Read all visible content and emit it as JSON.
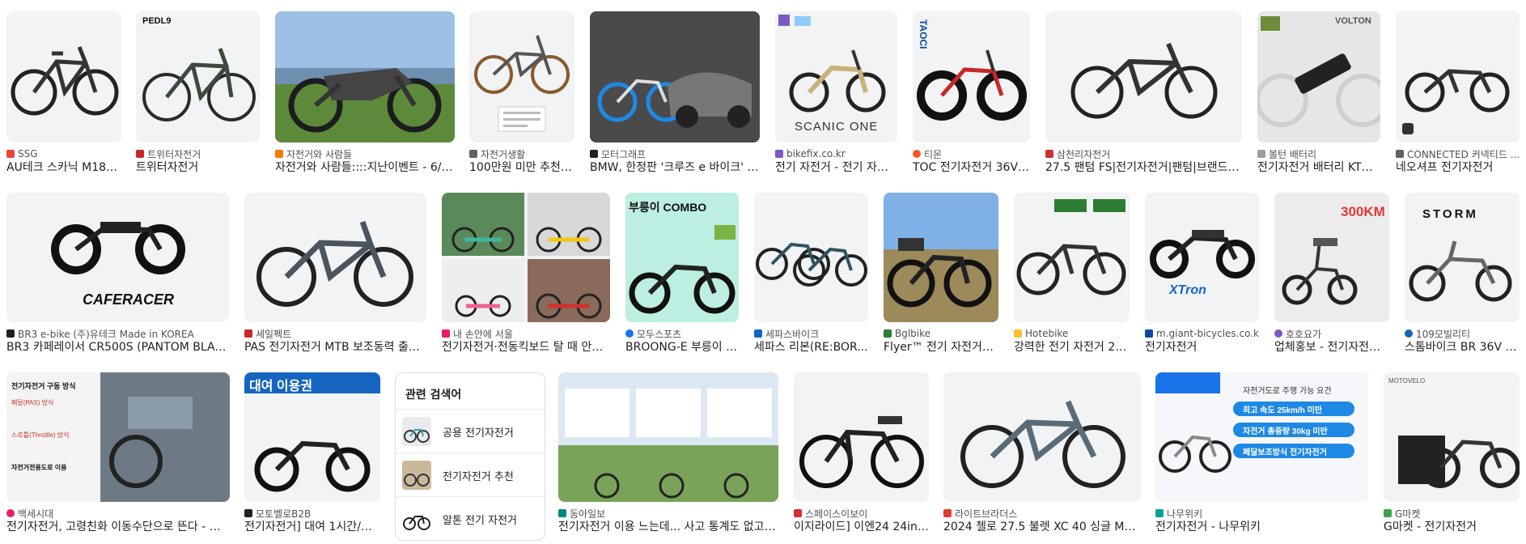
{
  "results": [
    {
      "source": "SSG",
      "title": "AU테크 스카닉 M180 ...",
      "favicon": "#e8453c"
    },
    {
      "source": "트위터자전거",
      "title": "트위터자전거",
      "favicon": "#c62828",
      "overlay": "PEDL9"
    },
    {
      "source": "자전거와 사람들",
      "title": "자전거와 사람들::::지난이벤트 - 6/3(...",
      "favicon": "#f57c00"
    },
    {
      "source": "자전거생활",
      "title": "100만원 미만 추천 ...",
      "favicon": "#5f6368"
    },
    {
      "source": "모터그래프",
      "title": "BMW, 한정판 '크루즈 e 바이크' 공...",
      "favicon": "#202124"
    },
    {
      "source": "bikefix.co.kr",
      "title": "전기 자전거 - 전기 자전...",
      "favicon": "#7e57c2",
      "overlay": "SCANIC ONE"
    },
    {
      "source": "티몬",
      "title": "TOC 전기자전거 36V ...",
      "favicon": "#ff5722",
      "overlay": "TAOCI"
    },
    {
      "source": "삼천리자전거",
      "title": "27.5 팬텀 FS|전기자전거|팬텀|브랜드|자...",
      "favicon": "#d32f2f"
    },
    {
      "source": "볼턴 배터리",
      "title": "전기자전거 배터리 KTX ...",
      "favicon": "#9e9e9e",
      "overlay": "VOLTON"
    },
    {
      "source": "CONNECTED 커넥티드 ...",
      "title": "네오셔프 전기자전거",
      "favicon": "#616161"
    },
    {
      "source": "BR3 e-bike (주)유테크 Made in KOREA",
      "title": "BR3 카페레이서 CR500S (PANTOM BLACK)...",
      "favicon": "#202124",
      "overlay": "CAFERACER"
    },
    {
      "source": "세일펙트",
      "title": "PAS 전기자전거 MTB 보조동력 출퇴...",
      "favicon": "#c62828"
    },
    {
      "source": "내 손안에 서울",
      "title": "전기자전거·전동킥보드 탈 때 안전...",
      "favicon": "#e91e63"
    },
    {
      "source": "모두스포츠",
      "title": "BROONG-E 부릉이 C...",
      "favicon": "#1a73e8",
      "overlay": "부릉이 COMBO"
    },
    {
      "source": "세파스바이크",
      "title": "세파스 리본(RE:BOR...",
      "favicon": "#1565c0"
    },
    {
      "source": "Bglbike",
      "title": "Flyer™ 전기 자전거의...",
      "favicon": "#2e7d32"
    },
    {
      "source": "Hotebike",
      "title": "강력한 전기 자전거 26...",
      "favicon": "#fbc02d"
    },
    {
      "source": "m.giant-bicycles.co.kr",
      "title": "전기자전거",
      "favicon": "#0d47a1",
      "overlay": "XTron"
    },
    {
      "source": "호호요가",
      "title": "업체홍보 - 전기자전거 ...",
      "favicon": "#7e57c2",
      "overlay": "300KM"
    },
    {
      "source": "109모빌리티",
      "title": "스톰바이크 BR 36V 7...",
      "favicon": "#1565c0",
      "overlay": "STORM"
    },
    {
      "source": "백세시대",
      "title": "전기자전거, 고령친화 이동수단으로 뜬다 - 백세...",
      "favicon": "#e91e63"
    },
    {
      "source": "모토벨로B2B",
      "title": "전기자전거] 대여 1시간/종...",
      "favicon": "#202124",
      "overlay": "대여 이용권"
    },
    {
      "source": "동아일보",
      "title": "전기자전거 이용 느는데... 사고 통계도 없고 안...",
      "favicon": "#00897b"
    },
    {
      "source": "스페이스이보이",
      "title": "이지라이드] 이엔24 24inch...",
      "favicon": "#d32f2f"
    },
    {
      "source": "라이트브라더스",
      "title": "2024 첼로 27.5 불렛 XC 40 싱글 MTB 센...",
      "favicon": "#e53935"
    },
    {
      "source": "나무위키",
      "title": "전기자전거 - 나무위키",
      "favicon": "#00a495"
    },
    {
      "source": "G마켓",
      "title": "G마켓 - 전기자전거",
      "favicon": "#43a047",
      "overlay": "MOTOVELO"
    }
  ],
  "related": {
    "title": "관련 검색어",
    "items": [
      {
        "label": "공용 전기자전거"
      },
      {
        "label": "전기자전거 추천"
      },
      {
        "label": "알톤 전기 자전거"
      }
    ]
  },
  "infographic": {
    "ebike_panel": {
      "heading": "전기자전거 구동 방식",
      "pas": "페달(PAS) 방식",
      "throttle": "스로틀(Throttle) 방식",
      "lane": "자전거전용도로 이용"
    },
    "nami_panel": {
      "heading": "자전거도로 주행 가능 요건",
      "req1": "최고 속도 25km/h 미만",
      "req2": "자전거 총중량 30kg 미만",
      "req3": "페달보조방식 전기자전거"
    }
  }
}
